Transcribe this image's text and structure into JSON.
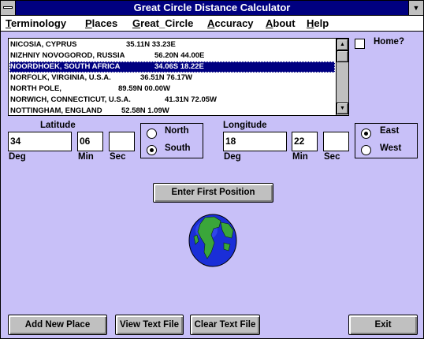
{
  "window": {
    "title": "Great Circle Distance Calculator"
  },
  "menu": {
    "items": [
      {
        "mnemonic": "T",
        "rest": "erminology"
      },
      {
        "mnemonic": "P",
        "rest": "laces"
      },
      {
        "mnemonic": "G",
        "rest": "reat_Circle"
      },
      {
        "mnemonic": "A",
        "rest": "ccuracy"
      },
      {
        "mnemonic": "A",
        "rest": "bout"
      },
      {
        "mnemonic": "H",
        "rest": "elp"
      }
    ]
  },
  "places": {
    "rows": [
      {
        "name": "NICOSIA, CYPRUS",
        "coords": "35.11N  33.23E"
      },
      {
        "name": "NIZHNIY NOVOGOROD, RUSSIA",
        "coords": "56.20N  44.00E"
      },
      {
        "name": "NOORDHOEK, SOUTH AFRICA",
        "coords": "34.06S  18.22E"
      },
      {
        "name": "NORFOLK, VIRGINIA, U.S.A.",
        "coords": "36.51N  76.17W"
      },
      {
        "name": "NORTH POLE,",
        "coords": "89.59N  00.00W"
      },
      {
        "name": "NORWICH, CONNECTICUT, U.S.A.",
        "coords": "41.31N  72.05W"
      },
      {
        "name": "NOTTINGHAM, ENGLAND",
        "coords": "52.58N   1.09W"
      }
    ],
    "selected_index": 2
  },
  "home": {
    "label": "Home?"
  },
  "latitude": {
    "heading": "Latitude",
    "deg": "34",
    "min": "06",
    "sec": "",
    "deg_label": "Deg",
    "min_label": "Min",
    "sec_label": "Sec",
    "north_label": "North",
    "south_label": "South",
    "selected": "South"
  },
  "longitude": {
    "heading": "Longitude",
    "deg": "18",
    "min": "22",
    "sec": "",
    "deg_label": "Deg",
    "min_label": "Min",
    "sec_label": "Sec",
    "east_label": "East",
    "west_label": "West",
    "selected": "East"
  },
  "buttons": {
    "enter_position": "Enter First Position",
    "add_place": "Add New Place",
    "view_text": "View Text File",
    "clear_text": "Clear Text File",
    "exit": "Exit"
  },
  "colors": {
    "title_bar": "#000080",
    "background": "#c8c0f8",
    "globe_ocean": "#1a2ed8",
    "globe_land": "#3aa63a"
  },
  "icons": {
    "globe": "globe-icon",
    "system_menu": "system-menu-icon",
    "minimize": "minimize-icon"
  }
}
